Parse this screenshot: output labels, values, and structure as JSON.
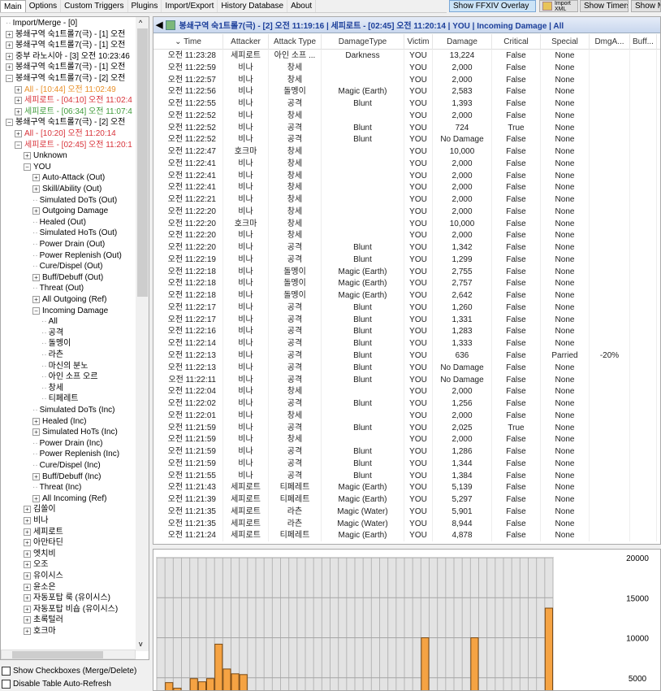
{
  "tabs": [
    "Main",
    "Options",
    "Custom Triggers",
    "Plugins",
    "Import/Export",
    "History Database",
    "About"
  ],
  "toolbar": {
    "overlay": "Show FFXIV Overlay",
    "import_xml": "Import XML",
    "timers": "Show Timers",
    "show_m": "Show M"
  },
  "tree": [
    {
      "t": "Import/Merge - [0]",
      "d": 0,
      "e": ""
    },
    {
      "t": "봉쇄구역 숙1트롤7(극) - [1] 오전 ",
      "d": 0,
      "e": "+"
    },
    {
      "t": "봉쇄구역 숙1트롤7(극) - [1] 오전 ",
      "d": 0,
      "e": "+"
    },
    {
      "t": "중부 라노시아 - [3] 오전 10:23:46",
      "d": 0,
      "e": "+"
    },
    {
      "t": "봉쇄구역 숙1트롤7(극) - [1] 오전 ",
      "d": 0,
      "e": "+"
    },
    {
      "t": "봉쇄구역 숙1트롤7(극) - [2] 오전 ",
      "d": 0,
      "e": "-"
    },
    {
      "t": "All - [10:44] 오전 11:02:49",
      "d": 1,
      "e": "+",
      "c": "#e8902a"
    },
    {
      "t": "세피로트 - [04:10] 오전 11:02:4",
      "d": 1,
      "e": "+",
      "c": "#d8333a"
    },
    {
      "t": "세피로트 - [06:34] 오전 11:07:4",
      "d": 1,
      "e": "+",
      "c": "#3f9a3a"
    },
    {
      "t": "봉쇄구역 숙1트롤7(극) - [2] 오전 ",
      "d": 0,
      "e": "-"
    },
    {
      "t": "All - [10:20] 오전 11:20:14",
      "d": 1,
      "e": "+",
      "c": "#d8333a"
    },
    {
      "t": "세피로트 - [02:45] 오전 11:20:1",
      "d": 1,
      "e": "-",
      "c": "#d8333a"
    },
    {
      "t": "Unknown",
      "d": 2,
      "e": "+"
    },
    {
      "t": "YOU",
      "d": 2,
      "e": "-"
    },
    {
      "t": "Auto-Attack (Out)",
      "d": 3,
      "e": "+"
    },
    {
      "t": "Skill/Ability (Out)",
      "d": 3,
      "e": "+"
    },
    {
      "t": "Simulated DoTs (Out)",
      "d": 3,
      "e": ""
    },
    {
      "t": "Outgoing Damage",
      "d": 3,
      "e": "+"
    },
    {
      "t": "Healed (Out)",
      "d": 3,
      "e": ""
    },
    {
      "t": "Simulated HoTs (Out)",
      "d": 3,
      "e": ""
    },
    {
      "t": "Power Drain (Out)",
      "d": 3,
      "e": ""
    },
    {
      "t": "Power Replenish (Out)",
      "d": 3,
      "e": ""
    },
    {
      "t": "Cure/Dispel (Out)",
      "d": 3,
      "e": ""
    },
    {
      "t": "Buff/Debuff (Out)",
      "d": 3,
      "e": "+"
    },
    {
      "t": "Threat (Out)",
      "d": 3,
      "e": ""
    },
    {
      "t": "All Outgoing (Ref)",
      "d": 3,
      "e": "+"
    },
    {
      "t": "Incoming Damage",
      "d": 3,
      "e": "-"
    },
    {
      "t": "All",
      "d": 4,
      "e": ""
    },
    {
      "t": "공격",
      "d": 4,
      "e": ""
    },
    {
      "t": "돌멩이",
      "d": 4,
      "e": ""
    },
    {
      "t": "라츤",
      "d": 4,
      "e": ""
    },
    {
      "t": "마신의 분노",
      "d": 4,
      "e": ""
    },
    {
      "t": "아인 소프 오르",
      "d": 4,
      "e": ""
    },
    {
      "t": "창세",
      "d": 4,
      "e": ""
    },
    {
      "t": "티페레트",
      "d": 4,
      "e": ""
    },
    {
      "t": "Simulated DoTs (Inc)",
      "d": 3,
      "e": ""
    },
    {
      "t": "Healed (Inc)",
      "d": 3,
      "e": "+"
    },
    {
      "t": "Simulated HoTs (Inc)",
      "d": 3,
      "e": "+"
    },
    {
      "t": "Power Drain (Inc)",
      "d": 3,
      "e": ""
    },
    {
      "t": "Power Replenish (Inc)",
      "d": 3,
      "e": ""
    },
    {
      "t": "Cure/Dispel (Inc)",
      "d": 3,
      "e": ""
    },
    {
      "t": "Buff/Debuff (Inc)",
      "d": 3,
      "e": "+"
    },
    {
      "t": "Threat (Inc)",
      "d": 3,
      "e": ""
    },
    {
      "t": "All Incoming (Ref)",
      "d": 3,
      "e": "+"
    },
    {
      "t": "김쏠이",
      "d": 2,
      "e": "+"
    },
    {
      "t": "비나",
      "d": 2,
      "e": "+"
    },
    {
      "t": "세피로트",
      "d": 2,
      "e": "+"
    },
    {
      "t": "아만타딘",
      "d": 2,
      "e": "+"
    },
    {
      "t": "엣치비",
      "d": 2,
      "e": "+"
    },
    {
      "t": "오조",
      "d": 2,
      "e": "+"
    },
    {
      "t": "유이시스",
      "d": 2,
      "e": "+"
    },
    {
      "t": "윤소은",
      "d": 2,
      "e": "+"
    },
    {
      "t": "자동포탑 룩 (유이시스)",
      "d": 2,
      "e": "+"
    },
    {
      "t": "자동포탑 비숍 (유이시스)",
      "d": 2,
      "e": "+"
    },
    {
      "t": "초록털러",
      "d": 2,
      "e": "+"
    },
    {
      "t": "호크마",
      "d": 2,
      "e": "+"
    }
  ],
  "options": {
    "show_checkboxes": "Show Checkboxes (Merge/Delete)",
    "disable_refresh": "Disable Table Auto-Refresh"
  },
  "encounter_title": "봉쇄구역 숙1트롤7(극) - [2] 오전 11:19:16 | 세피로트 - [02:45] 오전 11:20:14 | YOU | Incoming Damage | All",
  "columns": [
    "Time",
    "Attacker",
    "Attack Type",
    "DamageType",
    "Victim",
    "Damage",
    "Critical",
    "Special",
    "DmgA...",
    "Buff..."
  ],
  "rows": [
    [
      "오전 11:23:28",
      "세피로트",
      "아인 소프 ...",
      "Darkness",
      "YOU",
      "13,224",
      "False",
      "None"
    ],
    [
      "오전 11:22:59",
      "비나",
      "창세",
      "",
      "YOU",
      "2,000",
      "False",
      "None"
    ],
    [
      "오전 11:22:57",
      "비나",
      "창세",
      "",
      "YOU",
      "2,000",
      "False",
      "None"
    ],
    [
      "오전 11:22:56",
      "비나",
      "돌멩이",
      "Magic (Earth)",
      "YOU",
      "2,583",
      "False",
      "None"
    ],
    [
      "오전 11:22:55",
      "비나",
      "공격",
      "Blunt",
      "YOU",
      "1,393",
      "False",
      "None"
    ],
    [
      "오전 11:22:52",
      "비나",
      "창세",
      "",
      "YOU",
      "2,000",
      "False",
      "None"
    ],
    [
      "오전 11:22:52",
      "비나",
      "공격",
      "Blunt",
      "YOU",
      "724",
      "True",
      "None"
    ],
    [
      "오전 11:22:52",
      "비나",
      "공격",
      "Blunt",
      "YOU",
      "No Damage",
      "False",
      "None"
    ],
    [
      "오전 11:22:47",
      "호크마",
      "창세",
      "",
      "YOU",
      "10,000",
      "False",
      "None"
    ],
    [
      "오전 11:22:41",
      "비나",
      "창세",
      "",
      "YOU",
      "2,000",
      "False",
      "None"
    ],
    [
      "오전 11:22:41",
      "비나",
      "창세",
      "",
      "YOU",
      "2,000",
      "False",
      "None"
    ],
    [
      "오전 11:22:41",
      "비나",
      "창세",
      "",
      "YOU",
      "2,000",
      "False",
      "None"
    ],
    [
      "오전 11:22:21",
      "비나",
      "창세",
      "",
      "YOU",
      "2,000",
      "False",
      "None"
    ],
    [
      "오전 11:22:20",
      "비나",
      "창세",
      "",
      "YOU",
      "2,000",
      "False",
      "None"
    ],
    [
      "오전 11:22:20",
      "호크마",
      "창세",
      "",
      "YOU",
      "10,000",
      "False",
      "None"
    ],
    [
      "오전 11:22:20",
      "비나",
      "창세",
      "",
      "YOU",
      "2,000",
      "False",
      "None"
    ],
    [
      "오전 11:22:20",
      "비나",
      "공격",
      "Blunt",
      "YOU",
      "1,342",
      "False",
      "None"
    ],
    [
      "오전 11:22:19",
      "비나",
      "공격",
      "Blunt",
      "YOU",
      "1,299",
      "False",
      "None"
    ],
    [
      "오전 11:22:18",
      "비나",
      "돌멩이",
      "Magic (Earth)",
      "YOU",
      "2,755",
      "False",
      "None"
    ],
    [
      "오전 11:22:18",
      "비나",
      "돌멩이",
      "Magic (Earth)",
      "YOU",
      "2,757",
      "False",
      "None"
    ],
    [
      "오전 11:22:18",
      "비나",
      "돌멩이",
      "Magic (Earth)",
      "YOU",
      "2,642",
      "False",
      "None"
    ],
    [
      "오전 11:22:17",
      "비나",
      "공격",
      "Blunt",
      "YOU",
      "1,260",
      "False",
      "None"
    ],
    [
      "오전 11:22:17",
      "비나",
      "공격",
      "Blunt",
      "YOU",
      "1,331",
      "False",
      "None"
    ],
    [
      "오전 11:22:16",
      "비나",
      "공격",
      "Blunt",
      "YOU",
      "1,283",
      "False",
      "None"
    ],
    [
      "오전 11:22:14",
      "비나",
      "공격",
      "Blunt",
      "YOU",
      "1,333",
      "False",
      "None"
    ],
    [
      "오전 11:22:13",
      "비나",
      "공격",
      "Blunt",
      "YOU",
      "636",
      "False",
      "Parried",
      "-20%"
    ],
    [
      "오전 11:22:13",
      "비나",
      "공격",
      "Blunt",
      "YOU",
      "No Damage",
      "False",
      "None"
    ],
    [
      "오전 11:22:11",
      "비나",
      "공격",
      "Blunt",
      "YOU",
      "No Damage",
      "False",
      "None"
    ],
    [
      "오전 11:22:04",
      "비나",
      "창세",
      "",
      "YOU",
      "2,000",
      "False",
      "None"
    ],
    [
      "오전 11:22:02",
      "비나",
      "공격",
      "Blunt",
      "YOU",
      "1,256",
      "False",
      "None"
    ],
    [
      "오전 11:22:01",
      "비나",
      "창세",
      "",
      "YOU",
      "2,000",
      "False",
      "None"
    ],
    [
      "오전 11:21:59",
      "비나",
      "공격",
      "Blunt",
      "YOU",
      "2,025",
      "True",
      "None"
    ],
    [
      "오전 11:21:59",
      "비나",
      "창세",
      "",
      "YOU",
      "2,000",
      "False",
      "None"
    ],
    [
      "오전 11:21:59",
      "비나",
      "공격",
      "Blunt",
      "YOU",
      "1,286",
      "False",
      "None"
    ],
    [
      "오전 11:21:59",
      "비나",
      "공격",
      "Blunt",
      "YOU",
      "1,344",
      "False",
      "None"
    ],
    [
      "오전 11:21:55",
      "비나",
      "공격",
      "Blunt",
      "YOU",
      "1,384",
      "False",
      "None"
    ],
    [
      "오전 11:21:43",
      "세피로트",
      "티페레트",
      "Magic (Earth)",
      "YOU",
      "5,139",
      "False",
      "None"
    ],
    [
      "오전 11:21:39",
      "세피로트",
      "티페레트",
      "Magic (Earth)",
      "YOU",
      "5,297",
      "False",
      "None"
    ],
    [
      "오전 11:21:35",
      "세피로트",
      "라츤",
      "Magic (Water)",
      "YOU",
      "5,901",
      "False",
      "None"
    ],
    [
      "오전 11:21:35",
      "세피로트",
      "라츤",
      "Magic (Water)",
      "YOU",
      "8,944",
      "False",
      "None"
    ],
    [
      "오전 11:21:24",
      "세피로트",
      "티페레트",
      "Magic (Earth)",
      "YOU",
      "4,878",
      "False",
      "None"
    ]
  ],
  "chart_data": {
    "type": "bar",
    "ylim": [
      0,
      20000
    ],
    "yticks": [
      "20000",
      "15000",
      "10000",
      "5000"
    ],
    "values": [
      null,
      4400,
      3700,
      null,
      4900,
      4500,
      4900,
      9200,
      6100,
      5500,
      5400,
      null,
      null,
      null,
      null,
      null,
      null,
      null,
      null,
      null,
      null,
      null,
      null,
      null,
      null,
      null,
      null,
      null,
      null,
      null,
      null,
      null,
      10000,
      null,
      null,
      null,
      null,
      null,
      10000,
      null,
      null,
      null,
      null,
      null,
      null,
      null,
      null,
      13700
    ],
    "bar_color": "#f5a343",
    "grid": true
  },
  "colors": {
    "title": "#1c3f9a",
    "overlay_button": "#cce4f7"
  }
}
